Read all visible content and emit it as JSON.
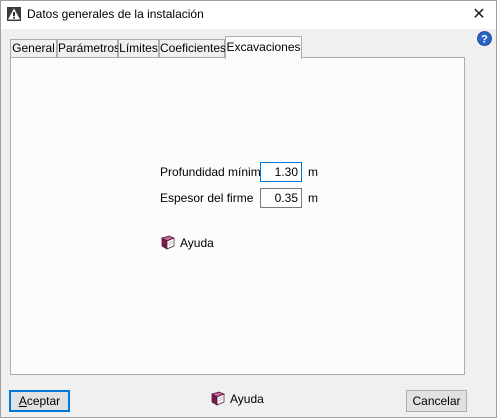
{
  "window": {
    "title": "Datos generales de la instalación",
    "close_glyph": "✕",
    "icon": "warning-triangle-icon",
    "help_icon": "question-circle-icon"
  },
  "tabs": [
    {
      "label": "General",
      "active": false
    },
    {
      "label": "Parámetros",
      "active": false
    },
    {
      "label": "Límites",
      "active": false
    },
    {
      "label": "Coeficientes",
      "active": false
    },
    {
      "label": "Excavaciones",
      "active": true
    }
  ],
  "form": {
    "profundidad": {
      "label": "Profundidad mínima",
      "value": "1.30",
      "unit": "m"
    },
    "espesor": {
      "label": "Espesor del firme",
      "value": "0.35",
      "unit": "m"
    },
    "help_label": "Ayuda"
  },
  "footer": {
    "accept_first": "A",
    "accept_rest": "ceptar",
    "help_label": "Ayuda",
    "cancel_label": "Cancelar"
  },
  "colors": {
    "focus_border": "#0078d7",
    "book_icon": "#7a1a4a"
  }
}
